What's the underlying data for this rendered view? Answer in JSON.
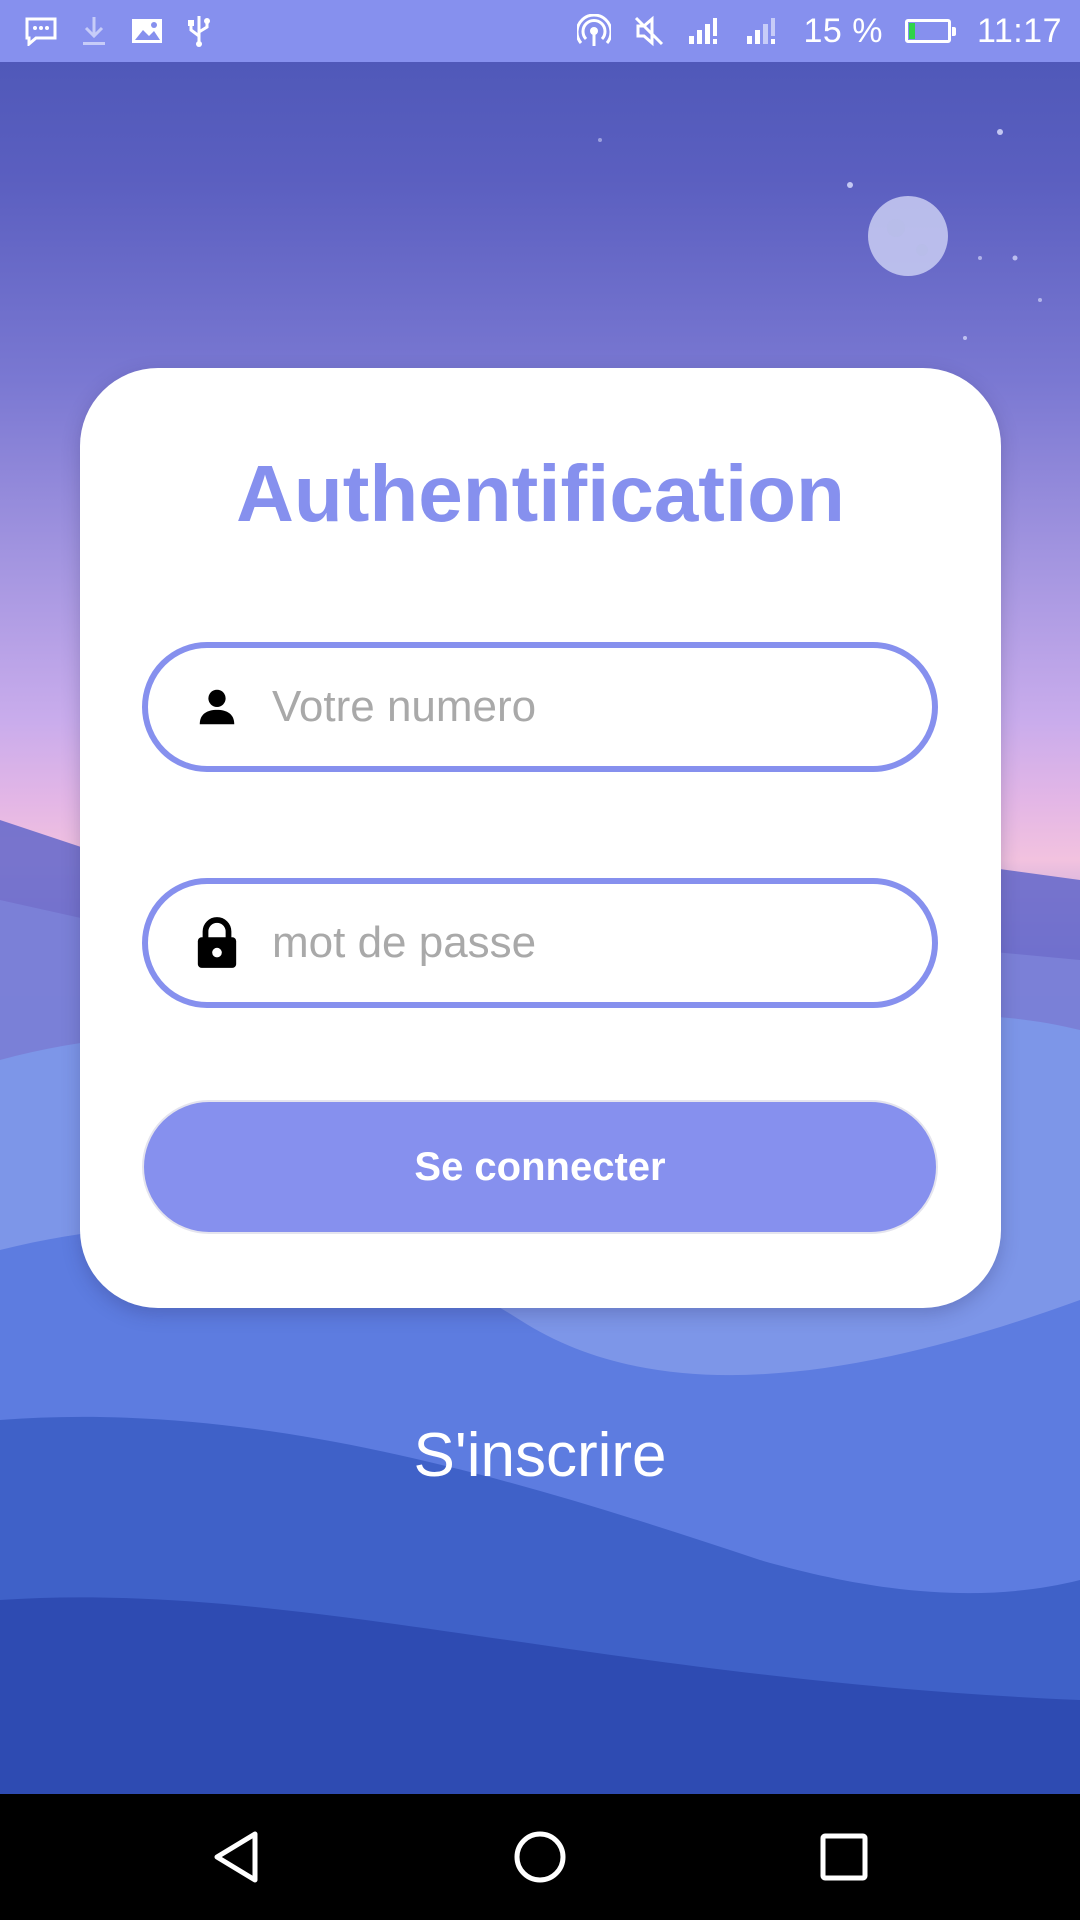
{
  "status_bar": {
    "icons_left": [
      "message-icon",
      "download-icon",
      "image-icon",
      "usb-icon"
    ],
    "icons_right": [
      "hotspot-icon",
      "mute-icon",
      "signal-icon",
      "signal-icon"
    ],
    "battery_percent_text": "15 %",
    "battery_level": 0.15,
    "time": "11:17"
  },
  "auth": {
    "title": "Authentification",
    "phone_placeholder": "Votre numero",
    "password_placeholder": "mot de passe",
    "login_label": "Se connecter"
  },
  "register": {
    "label": "S'inscrire"
  },
  "nav_bar": {
    "buttons": [
      "back-icon",
      "home-icon",
      "recents-icon"
    ]
  },
  "colors": {
    "accent": "#8690ee",
    "placeholder": "#a9a9a9",
    "card": "#ffffff"
  }
}
